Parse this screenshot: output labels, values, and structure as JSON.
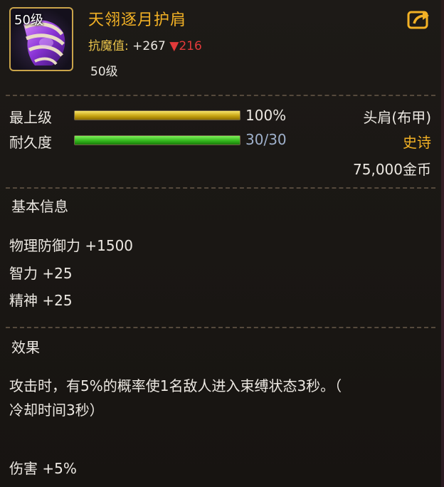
{
  "item": {
    "name": "天翎逐月护肩",
    "level_badge": "50级",
    "stat_label": "抗魔值:",
    "stat_bonus": "+267",
    "stat_compare_symbol": "▼",
    "stat_compare_value": "216",
    "level_text": "50级"
  },
  "bars": {
    "refine_label": "最上级",
    "refine_percent": 100,
    "refine_text": "100%",
    "durability_label": "耐久度",
    "durability_current": 30,
    "durability_max": 30,
    "durability_text": "30/30"
  },
  "meta": {
    "slot": "头肩(布甲)",
    "rarity": "史诗",
    "price": "75,000金币"
  },
  "basic_info": {
    "title": "基本信息",
    "attributes": [
      "物理防御力 +1500",
      "智力 +25",
      "精神 +25"
    ]
  },
  "effect": {
    "title": "效果",
    "line1": "攻击时，有5%的概率使1名敌人进入束缚状态3秒。（",
    "line2": "冷却时间3秒）",
    "bonus": "伤害 +5%"
  },
  "colors": {
    "name": "#f2b125",
    "rarity": "#f2b125",
    "stat_down": "#e23a3a",
    "durability_value": "#9fb0cb"
  },
  "icons": {
    "item_icon": "purple-shoulder-armor-icon",
    "share": "share-export-icon"
  }
}
